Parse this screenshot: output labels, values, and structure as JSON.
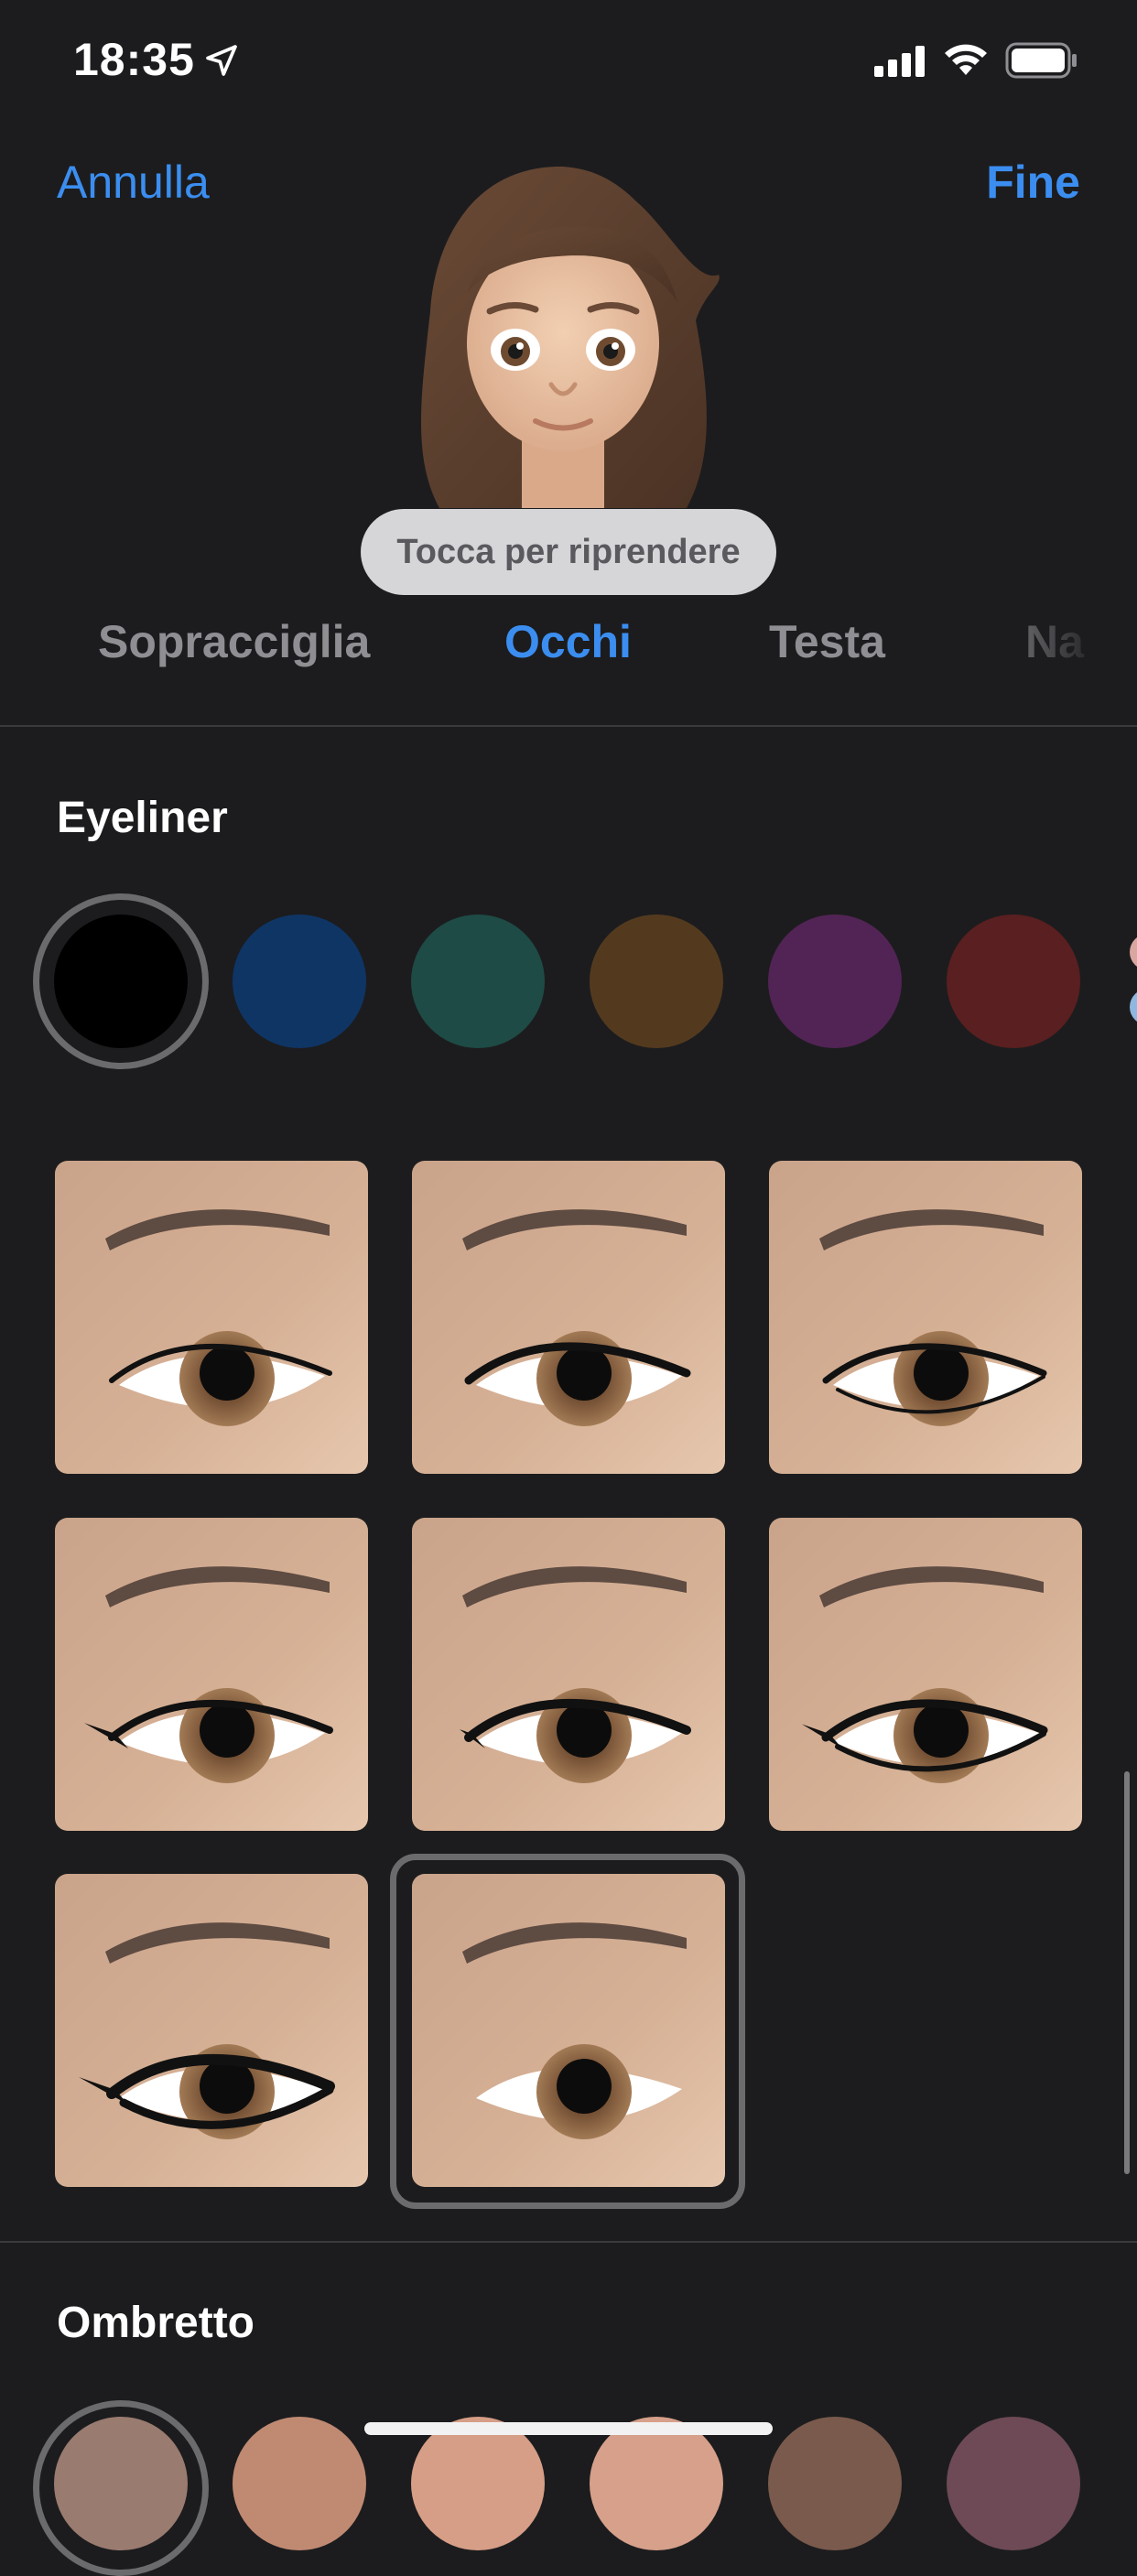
{
  "status_bar": {
    "time": "18:35"
  },
  "nav": {
    "cancel_label": "Annulla",
    "done_label": "Fine"
  },
  "retake_label": "Tocca per riprendere",
  "tabs": [
    {
      "label": "Sopracciglia",
      "active": false
    },
    {
      "label": "Occhi",
      "active": true
    },
    {
      "label": "Testa",
      "active": false
    },
    {
      "label": "Na",
      "active": false
    }
  ],
  "eyeliner": {
    "title": "Eyeliner",
    "colors": [
      "#000000",
      "#0f3565",
      "#1e4b45",
      "#533a1f",
      "#522455",
      "#5a1f20"
    ],
    "selected_color_index": 0,
    "styles_count_label": "",
    "selected_style_index": 7
  },
  "eyeshadow": {
    "title": "Ombretto",
    "colors": [
      "#9a7b70",
      "#c08a72",
      "#d69e86",
      "#d6a08a",
      "#7a5a4c",
      "#6d4a55"
    ]
  }
}
